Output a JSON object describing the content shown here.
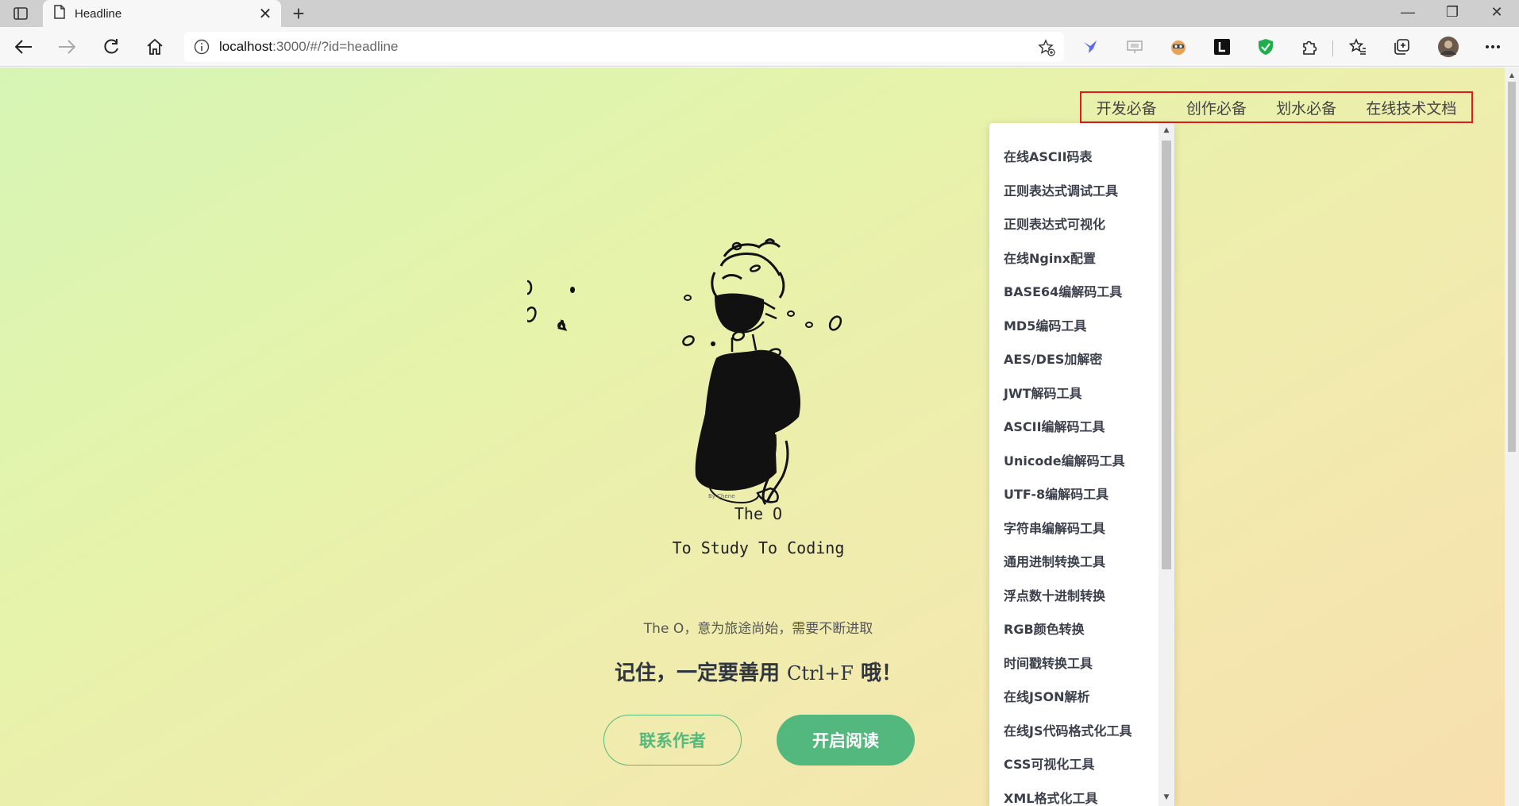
{
  "browser": {
    "tab_title": "Headline",
    "tab_close": "✕",
    "new_tab": "+",
    "url_host": "localhost",
    "url_path": ":3000/#/?id=headline",
    "window_controls": {
      "minimize": "—",
      "restore": "❐",
      "close": "✕"
    }
  },
  "nav": {
    "items": [
      "开发必备",
      "创作必备",
      "划水必备",
      "在线技术文档"
    ]
  },
  "dropdown": {
    "items": [
      "在线ASCII码表",
      "正则表达式调试工具",
      "正则表达式可视化",
      "在线Nginx配置",
      "BASE64编解码工具",
      "MD5编码工具",
      "AES/DES加解密",
      "JWT解码工具",
      "ASCII编解码工具",
      "Unicode编解码工具",
      "UTF-8编解码工具",
      "字符串编解码工具",
      "通用进制转换工具",
      "浮点数十进制转换",
      "RGB颜色转换",
      "时间戳转换工具",
      "在线JSON解析",
      "在线JS代码格式化工具",
      "CSS可视化工具",
      "XML格式化工具"
    ]
  },
  "hero": {
    "title": "The O",
    "subtitle": "To Study To Coding",
    "description": "The O，意为旅途尚始，需要不断进取",
    "remember_prefix": "记住，一定要善用 ",
    "remember_key": "Ctrl+F",
    "remember_suffix": " 哦！",
    "contact_button": "联系作者",
    "read_button": "开启阅读"
  },
  "colors": {
    "accent_green": "#52b87e",
    "nav_highlight_border": "#e21b1b"
  }
}
